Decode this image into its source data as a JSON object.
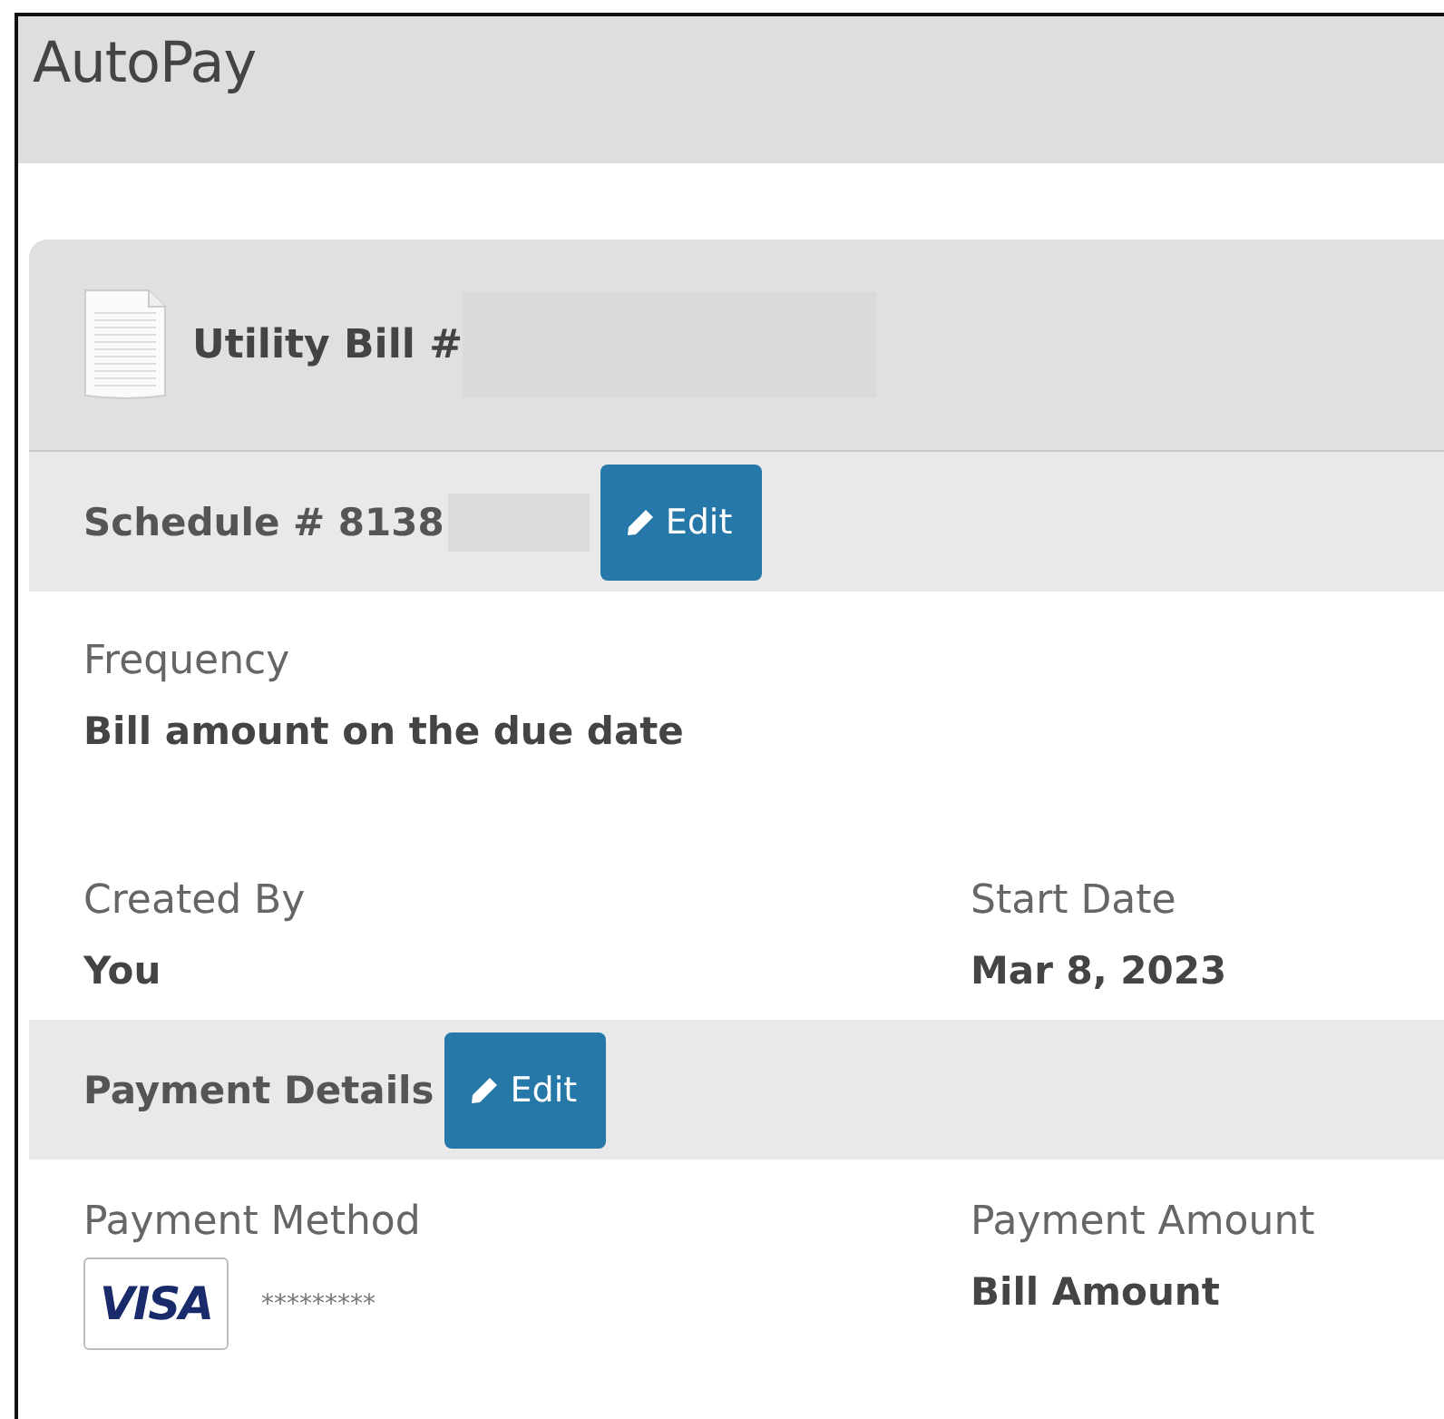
{
  "page": {
    "title": "AutoPay"
  },
  "bill": {
    "title": "Utility Bill #",
    "number_redacted": true
  },
  "schedule": {
    "title": "Schedule # 8138",
    "number_redacted": true,
    "edit_button": "Edit",
    "fields": [
      {
        "label": "Frequency",
        "value": "Bill amount on the due date",
        "kind": "wide"
      },
      {
        "label": "Created By",
        "value": "You",
        "kind": "half"
      },
      {
        "label": "Start Date",
        "value": "Mar 8, 2023",
        "kind": "half"
      }
    ]
  },
  "payment": {
    "title": "Payment Details",
    "edit_button": "Edit",
    "method": {
      "label": "Payment Method",
      "card_brand": "VISA",
      "masked_number": "*********"
    },
    "amount": {
      "label": "Payment Amount",
      "value": "Bill Amount"
    }
  }
}
